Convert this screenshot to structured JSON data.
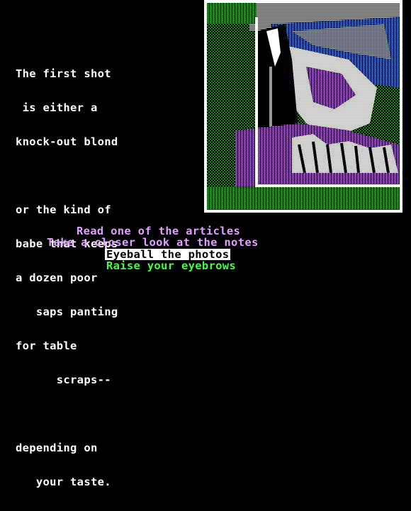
{
  "scene": {
    "narration_lines": [
      "The first shot",
      " is either a",
      "knock-out blond",
      "",
      "or the kind of",
      "babe that keeps",
      "a dozen poor",
      "   saps panting",
      "for table",
      "      scraps--",
      "",
      "depending on",
      "   your taste."
    ],
    "photo": {
      "subject": "photograph-of-blond-woman",
      "palette": {
        "frame": "#ffffff",
        "black": "#000000",
        "green": "#40c040",
        "purple": "#d080ff",
        "blue": "#6090ff",
        "white": "#ffffff"
      }
    }
  },
  "menu": {
    "items": [
      {
        "label": "Read one of the articles",
        "color": "#e0a0ff",
        "selected": false
      },
      {
        "label": "Take a closer look at the notes",
        "color": "#e0a0ff",
        "selected": false
      },
      {
        "label": "Eyeball the photos",
        "color": "#40ff40",
        "selected": true
      },
      {
        "label": "Raise your eyebrows",
        "color": "#40ff40",
        "selected": false
      }
    ]
  }
}
